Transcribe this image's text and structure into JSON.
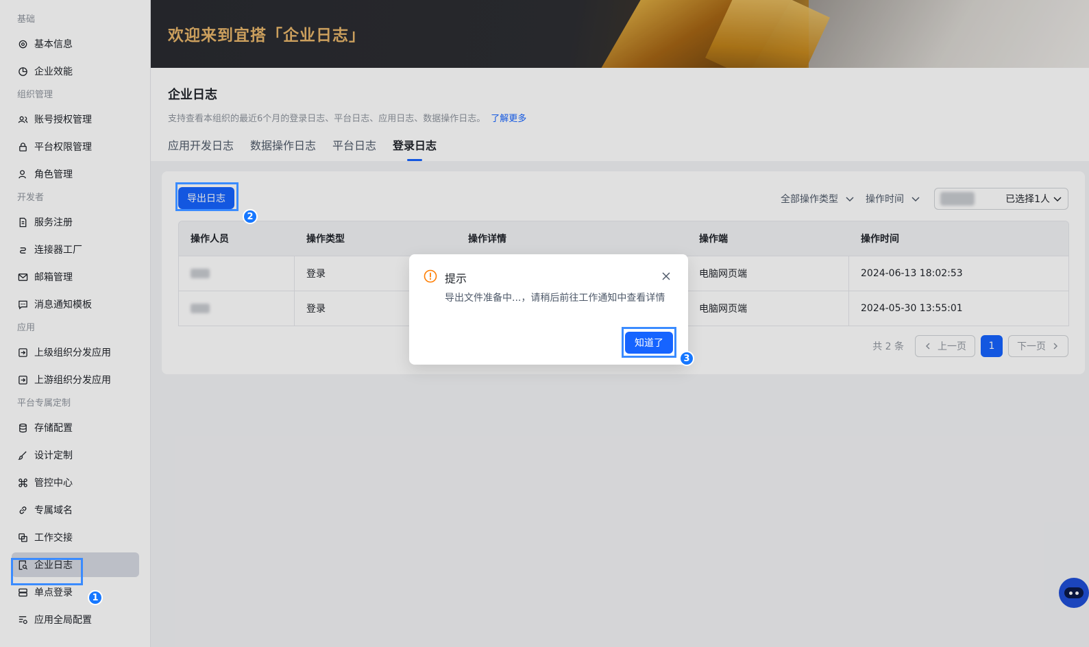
{
  "sidebar": {
    "groups": [
      {
        "title": "基础",
        "items": [
          "基本信息",
          "企业效能"
        ]
      },
      {
        "title": "组织管理",
        "items": [
          "账号授权管理",
          "平台权限管理",
          "角色管理"
        ]
      },
      {
        "title": "开发者",
        "items": [
          "服务注册",
          "连接器工厂",
          "邮箱管理",
          "消息通知模板"
        ]
      },
      {
        "title": "应用",
        "items": [
          "上级组织分发应用",
          "上游组织分发应用"
        ]
      },
      {
        "title": "平台专属定制",
        "items": [
          "存储配置",
          "设计定制",
          "管控中心",
          "专属域名",
          "工作交接",
          "企业日志",
          "单点登录",
          "应用全局配置"
        ]
      }
    ]
  },
  "banner": {
    "title": "欢迎来到宜搭「企业日志」"
  },
  "page": {
    "title": "企业日志",
    "desc": "支持查看本组织的最近6个月的登录日志、平台日志、应用日志、数据操作日志。",
    "learn_more": "了解更多",
    "tabs": [
      "应用开发日志",
      "数据操作日志",
      "平台日志",
      "登录日志"
    ],
    "active_tab": "登录日志"
  },
  "toolbar": {
    "export_label": "导出日志",
    "filter_type": "全部操作类型",
    "filter_time": "操作时间",
    "person_selected": "已选择1人"
  },
  "table": {
    "headers": [
      "操作人员",
      "操作类型",
      "操作详情",
      "操作端",
      "操作时间"
    ],
    "rows": [
      {
        "type": "登录",
        "detail": "",
        "client": "电脑网页端",
        "time": "2024-06-13 18:02:53"
      },
      {
        "type": "登录",
        "detail": "",
        "client": "电脑网页端",
        "time": "2024-05-30 13:55:01"
      }
    ]
  },
  "pager": {
    "total": "共 2 条",
    "prev": "上一页",
    "page": "1",
    "next": "下一页"
  },
  "modal": {
    "title": "提示",
    "content": "导出文件准备中...，请稍后前往工作通知中查看详情",
    "ok_label": "知道了"
  },
  "badges": [
    "1",
    "2",
    "3"
  ],
  "colors": {
    "accent": "#1664ff",
    "highlight": "#3a8bff",
    "warning": "#ff7d00"
  }
}
